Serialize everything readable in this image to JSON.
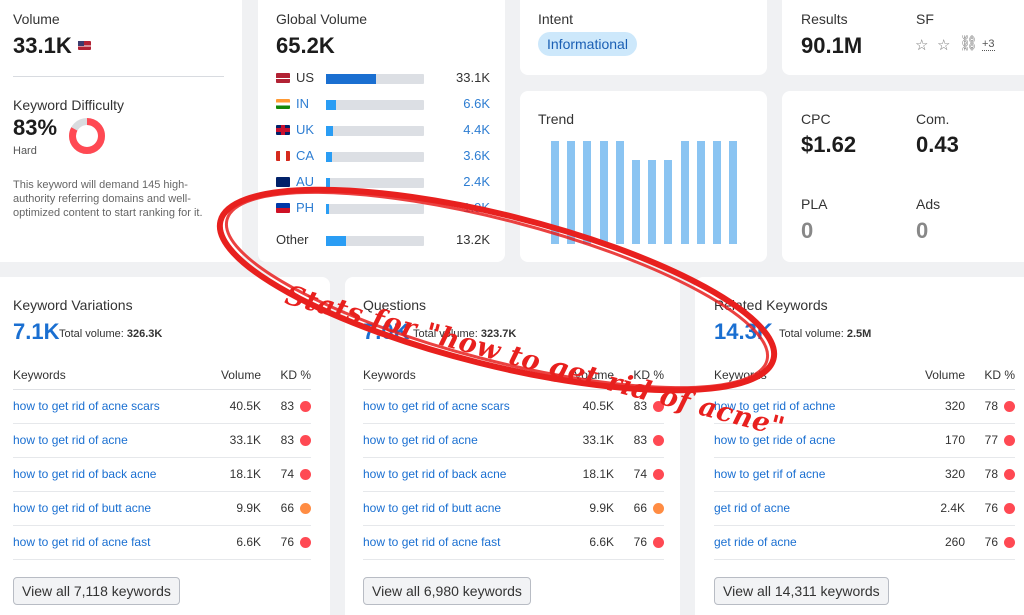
{
  "volume": {
    "label": "Volume",
    "value": "33.1K"
  },
  "kd": {
    "label": "Keyword Difficulty",
    "value": "83%",
    "level": "Hard",
    "percent": 83,
    "description": "This keyword will demand 145 high-authority referring domains and well-optimized content to start ranking for it."
  },
  "global": {
    "label": "Global Volume",
    "value": "65.2K",
    "rows": [
      {
        "code": "US",
        "value": "33.1K",
        "share": 0.51
      },
      {
        "code": "IN",
        "value": "6.6K",
        "share": 0.1
      },
      {
        "code": "UK",
        "value": "4.4K",
        "share": 0.07
      },
      {
        "code": "CA",
        "value": "3.6K",
        "share": 0.06
      },
      {
        "code": "AU",
        "value": "2.4K",
        "share": 0.04
      },
      {
        "code": "PH",
        "value": "1.9K",
        "share": 0.03
      }
    ],
    "other_label": "Other",
    "other_value": "13.2K",
    "other_share": 0.2
  },
  "intent": {
    "label": "Intent",
    "badge": "Informational"
  },
  "trend": {
    "label": "Trend",
    "values": [
      0.79,
      0.79,
      0.79,
      0.79,
      0.79,
      0.65,
      0.65,
      0.65,
      0.79,
      0.79,
      0.79,
      0.79
    ]
  },
  "results": {
    "label": "Results",
    "value": "90.1M",
    "sf_label": "SF",
    "sf_more": "+3"
  },
  "cpc": {
    "label": "CPC",
    "value": "$1.62",
    "com_label": "Com.",
    "com_value": "0.43",
    "pla_label": "PLA",
    "pla_value": "0",
    "ads_label": "Ads",
    "ads_value": "0"
  },
  "annotation": "Stats for \"how to get rid of acne\"",
  "panels": [
    {
      "title": "Keyword Variations",
      "count": "7.1K",
      "total_label": "Total volume:",
      "total_value": "326.3K",
      "headers": [
        "Keywords",
        "Volume",
        "KD %"
      ],
      "rows": [
        {
          "keyword": "how to get rid of acne scars",
          "volume": "40.5K",
          "kd": "83",
          "color": "#ff4953"
        },
        {
          "keyword": "how to get rid of acne",
          "volume": "33.1K",
          "kd": "83",
          "color": "#ff4953"
        },
        {
          "keyword": "how to get rid of back acne",
          "volume": "18.1K",
          "kd": "74",
          "color": "#ff4953"
        },
        {
          "keyword": "how to get rid of butt acne",
          "volume": "9.9K",
          "kd": "66",
          "color": "#ff8c43"
        },
        {
          "keyword": "how to get rid of acne fast",
          "volume": "6.6K",
          "kd": "76",
          "color": "#ff4953"
        }
      ],
      "button": "View all 7,118 keywords"
    },
    {
      "title": "Questions",
      "count": "7.0K",
      "total_label": "Total volume:",
      "total_value": "323.7K",
      "headers": [
        "Keywords",
        "Volume",
        "KD %"
      ],
      "rows": [
        {
          "keyword": "how to get rid of acne scars",
          "volume": "40.5K",
          "kd": "83",
          "color": "#ff4953"
        },
        {
          "keyword": "how to get rid of acne",
          "volume": "33.1K",
          "kd": "83",
          "color": "#ff4953"
        },
        {
          "keyword": "how to get rid of back acne",
          "volume": "18.1K",
          "kd": "74",
          "color": "#ff4953"
        },
        {
          "keyword": "how to get rid of butt acne",
          "volume": "9.9K",
          "kd": "66",
          "color": "#ff8c43"
        },
        {
          "keyword": "how to get rid of acne fast",
          "volume": "6.6K",
          "kd": "76",
          "color": "#ff4953"
        }
      ],
      "button": "View all 6,980 keywords"
    },
    {
      "title": "Related Keywords",
      "count": "14.3K",
      "total_label": "Total volume:",
      "total_value": "2.5M",
      "headers": [
        "Keywords",
        "Volume",
        "KD %"
      ],
      "rows": [
        {
          "keyword": "how to get rid of achne",
          "volume": "320",
          "kd": "78",
          "color": "#ff4953"
        },
        {
          "keyword": "how to get ride of acne",
          "volume": "170",
          "kd": "77",
          "color": "#ff4953"
        },
        {
          "keyword": "how to get rif of acne",
          "volume": "320",
          "kd": "78",
          "color": "#ff4953"
        },
        {
          "keyword": "get rid of acne",
          "volume": "2.4K",
          "kd": "76",
          "color": "#ff4953"
        },
        {
          "keyword": "get ride of acne",
          "volume": "260",
          "kd": "76",
          "color": "#ff4953"
        }
      ],
      "button": "View all 14,311 keywords"
    }
  ]
}
